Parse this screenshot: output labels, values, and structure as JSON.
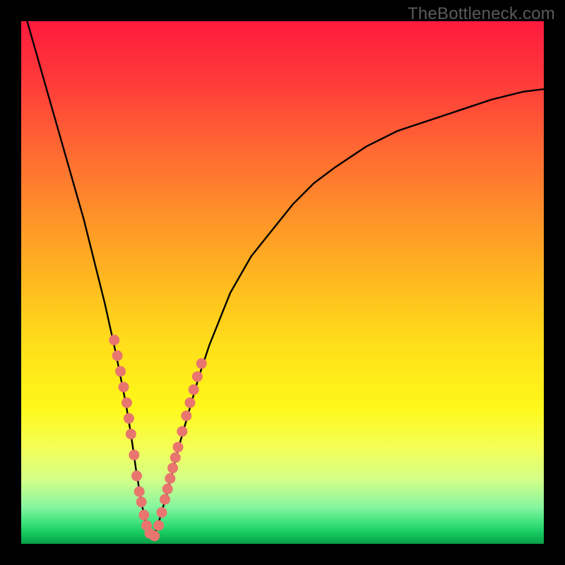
{
  "watermark": "TheBottleneck.com",
  "colors": {
    "frame_bg": "#000000",
    "curve_stroke": "#000000",
    "dot_fill": "#e8766e",
    "gradient_top": "#ff1a3e",
    "gradient_bottom": "#0a9e48"
  },
  "chart_data": {
    "type": "line",
    "title": "",
    "xlabel": "",
    "ylabel": "",
    "xlim": [
      0,
      100
    ],
    "ylim": [
      0,
      100
    ],
    "series": [
      {
        "name": "bottleneck-curve",
        "x": [
          0,
          2,
          4,
          6,
          8,
          10,
          12,
          14,
          16,
          18,
          20,
          21,
          22,
          23,
          24,
          25,
          26,
          28,
          30,
          32,
          34,
          36,
          38,
          40,
          44,
          48,
          52,
          56,
          60,
          66,
          72,
          78,
          84,
          90,
          96,
          100
        ],
        "values": [
          104,
          97,
          90,
          83,
          76,
          69,
          62,
          54,
          46,
          37,
          27,
          21,
          14,
          8,
          3,
          1,
          3,
          10,
          18,
          25,
          32,
          38,
          43,
          48,
          55,
          60,
          65,
          69,
          72,
          76,
          79,
          81,
          83,
          85,
          86.5,
          87
        ]
      },
      {
        "name": "markers",
        "points": [
          {
            "x": 17.8,
            "y": 39
          },
          {
            "x": 18.4,
            "y": 36
          },
          {
            "x": 19.0,
            "y": 33
          },
          {
            "x": 19.6,
            "y": 30
          },
          {
            "x": 20.2,
            "y": 27
          },
          {
            "x": 20.6,
            "y": 24
          },
          {
            "x": 21.0,
            "y": 21
          },
          {
            "x": 21.6,
            "y": 17
          },
          {
            "x": 22.1,
            "y": 13
          },
          {
            "x": 22.6,
            "y": 10
          },
          {
            "x": 23.0,
            "y": 8
          },
          {
            "x": 23.5,
            "y": 5.5
          },
          {
            "x": 24.0,
            "y": 3.5
          },
          {
            "x": 24.6,
            "y": 2
          },
          {
            "x": 25.5,
            "y": 1.5
          },
          {
            "x": 26.3,
            "y": 3.5
          },
          {
            "x": 26.9,
            "y": 6
          },
          {
            "x": 27.5,
            "y": 8.5
          },
          {
            "x": 28.0,
            "y": 10.5
          },
          {
            "x": 28.5,
            "y": 12.5
          },
          {
            "x": 29.0,
            "y": 14.5
          },
          {
            "x": 29.5,
            "y": 16.5
          },
          {
            "x": 30.0,
            "y": 18.5
          },
          {
            "x": 30.8,
            "y": 21.5
          },
          {
            "x": 31.6,
            "y": 24.5
          },
          {
            "x": 32.3,
            "y": 27
          },
          {
            "x": 33.0,
            "y": 29.5
          },
          {
            "x": 33.7,
            "y": 32
          },
          {
            "x": 34.5,
            "y": 34.5
          }
        ]
      }
    ],
    "grid": false,
    "legend": false
  }
}
